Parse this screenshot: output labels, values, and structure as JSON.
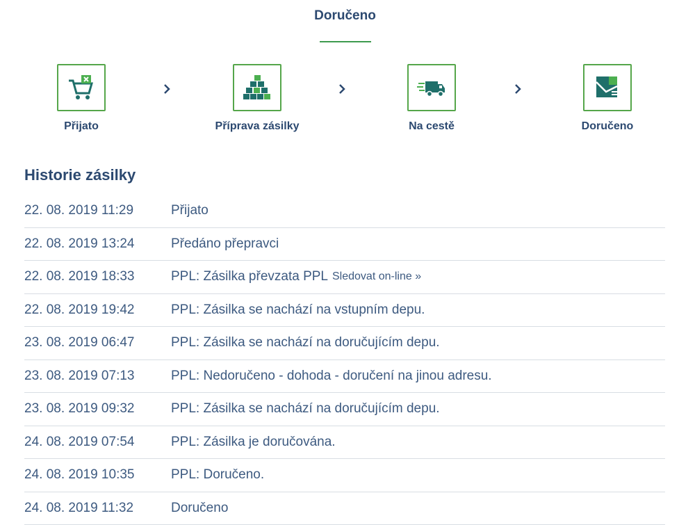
{
  "status": {
    "title": "Doručeno"
  },
  "steps": [
    {
      "label": "Přijato",
      "icon": "cart-cancel-icon"
    },
    {
      "label": "Příprava zásilky",
      "icon": "boxes-icon"
    },
    {
      "label": "Na cestě",
      "icon": "delivery-truck-icon"
    },
    {
      "label": "Doručeno",
      "icon": "delivered-package-icon"
    }
  ],
  "history": {
    "title": "Historie zásilky",
    "rows": [
      {
        "date": "22. 08. 2019 11:29",
        "event": "Přijato"
      },
      {
        "date": "22. 08. 2019 13:24",
        "event": "Předáno přepravci"
      },
      {
        "date": "22. 08. 2019 18:33",
        "event": "PPL: Zásilka převzata PPL",
        "link": "Sledovat on-line »"
      },
      {
        "date": "22. 08. 2019 19:42",
        "event": "PPL: Zásilka se nachází na vstupním depu."
      },
      {
        "date": "23. 08. 2019 06:47",
        "event": "PPL: Zásilka se nachází na doručujícím depu."
      },
      {
        "date": "23. 08. 2019 07:13",
        "event": "PPL: Nedoručeno - dohoda - doručení na jinou adresu."
      },
      {
        "date": "23. 08. 2019 09:32",
        "event": "PPL: Zásilka se nachází na doručujícím depu."
      },
      {
        "date": "24. 08. 2019 07:54",
        "event": "PPL: Zásilka je doručována."
      },
      {
        "date": "24. 08. 2019 10:35",
        "event": "PPL: Doručeno."
      },
      {
        "date": "24. 08. 2019 11:32",
        "event": "Doručeno"
      }
    ]
  },
  "colors": {
    "accent_green": "#55a64a",
    "icon_teal": "#1f6f6a",
    "text_navy": "#2c4970"
  }
}
